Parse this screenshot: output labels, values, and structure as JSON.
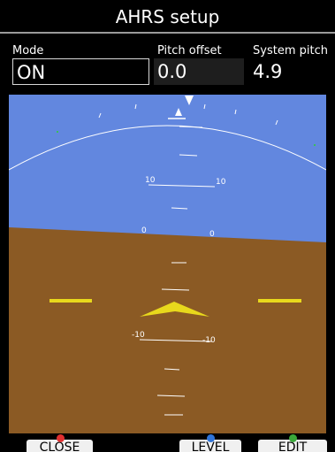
{
  "title": "AHRS setup",
  "fields": {
    "mode": {
      "label": "Mode",
      "value": "ON"
    },
    "pitch_offset": {
      "label": "Pitch offset",
      "value": "0.0"
    },
    "system_pitch": {
      "label": "System pitch",
      "value": "4.9"
    }
  },
  "horizon": {
    "pitch_labels": [
      {
        "left": "10",
        "right": "10"
      },
      {
        "left": "0",
        "right": "0"
      },
      {
        "left": "-10",
        "right": "-10"
      }
    ]
  },
  "buttons": {
    "close": {
      "label": "CLOSE",
      "indicator": "#e03030"
    },
    "level": {
      "label": "LEVEL",
      "indicator": "#2f74d8"
    },
    "edit": {
      "label": "EDIT",
      "indicator": "#3aa83a"
    }
  },
  "colors": {
    "sky": "#6287df",
    "ground": "#8b5a24",
    "aircraft": "#e8d81c"
  }
}
